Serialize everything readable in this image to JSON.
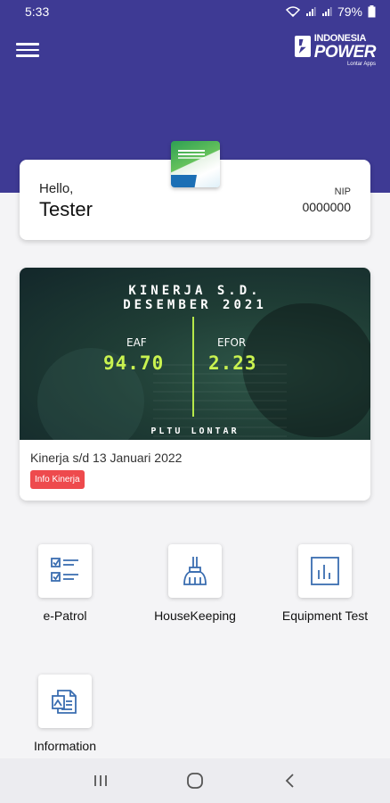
{
  "status_bar": {
    "time": "5:33",
    "battery": "79%",
    "icons": [
      "wifi-icon",
      "signal-icon",
      "signal-icon",
      "battery-icon"
    ]
  },
  "header": {
    "menu_icon": "hamburger-menu-icon",
    "brand": {
      "line1": "INDONESIA",
      "line2": "POWER",
      "line3": "Lontar Apps"
    },
    "color": "#3e3a94"
  },
  "profile": {
    "greeting": "Hello,",
    "name": "Tester",
    "nip_label": "NIP",
    "nip_value": "0000000"
  },
  "performance": {
    "banner": {
      "title_line1": "KINERJA S.D.",
      "title_line2": "DESEMBER 2021",
      "eaf_label": "EAF",
      "eaf_value": "94.70",
      "efor_label": "EFOR",
      "efor_value": "2.23",
      "plant": "PLTU LONTAR"
    },
    "caption": "Kinerja s/d 13 Januari 2022",
    "badge": "Info Kinerja",
    "badge_color": "#ee4a4d",
    "accent_color": "#c9f250"
  },
  "menu": {
    "items": [
      {
        "label": "e-Patrol",
        "icon": "checklist-icon"
      },
      {
        "label": "HouseKeeping",
        "icon": "broom-icon"
      },
      {
        "label": "Equipment Test",
        "icon": "bar-chart-icon"
      },
      {
        "label": "Information",
        "icon": "documents-icon"
      }
    ],
    "icon_color": "#3a6db0"
  },
  "nav_bar": {
    "buttons": [
      "recent-apps-icon",
      "home-icon",
      "back-icon"
    ]
  }
}
